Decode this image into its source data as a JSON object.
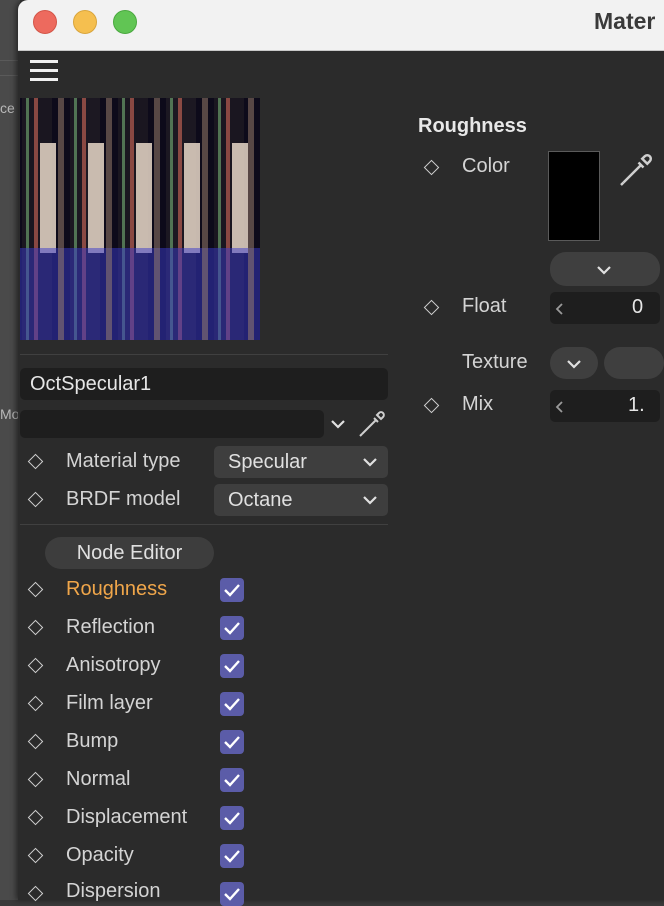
{
  "background_app": {
    "partial_labels": [
      "ce",
      "Mo"
    ]
  },
  "window": {
    "title": "Mater"
  },
  "material": {
    "name": "OctSpecular1",
    "secondary_value": "",
    "material_type": {
      "label": "Material type",
      "value": "Specular"
    },
    "brdf_model": {
      "label": "BRDF model",
      "value": "Octane"
    },
    "node_editor_label": "Node Editor"
  },
  "channels": [
    {
      "label": "Roughness",
      "checked": true,
      "active": true
    },
    {
      "label": "Reflection",
      "checked": true,
      "active": false
    },
    {
      "label": "Anisotropy",
      "checked": true,
      "active": false
    },
    {
      "label": "Film layer",
      "checked": true,
      "active": false
    },
    {
      "label": "Bump",
      "checked": true,
      "active": false
    },
    {
      "label": "Normal",
      "checked": true,
      "active": false
    },
    {
      "label": "Displacement",
      "checked": true,
      "active": false
    },
    {
      "label": "Opacity",
      "checked": true,
      "active": false
    },
    {
      "label": "Dispersion",
      "checked": true,
      "active": false
    }
  ],
  "roughness_panel": {
    "title": "Roughness",
    "color_label": "Color",
    "color_value": "#000000",
    "float_label": "Float",
    "float_value": "0",
    "texture_label": "Texture",
    "mix_label": "Mix",
    "mix_value": "1."
  },
  "colors": {
    "accent_active": "#f0a64a",
    "checkbox": "#5b5ca8",
    "panel_bg": "#2b2b2b"
  },
  "icons": [
    "hamburger-menu-icon",
    "eyedropper-icon",
    "chevron-down-icon",
    "chevron-left-icon",
    "diamond-keyframe-icon",
    "checkmark-icon"
  ]
}
